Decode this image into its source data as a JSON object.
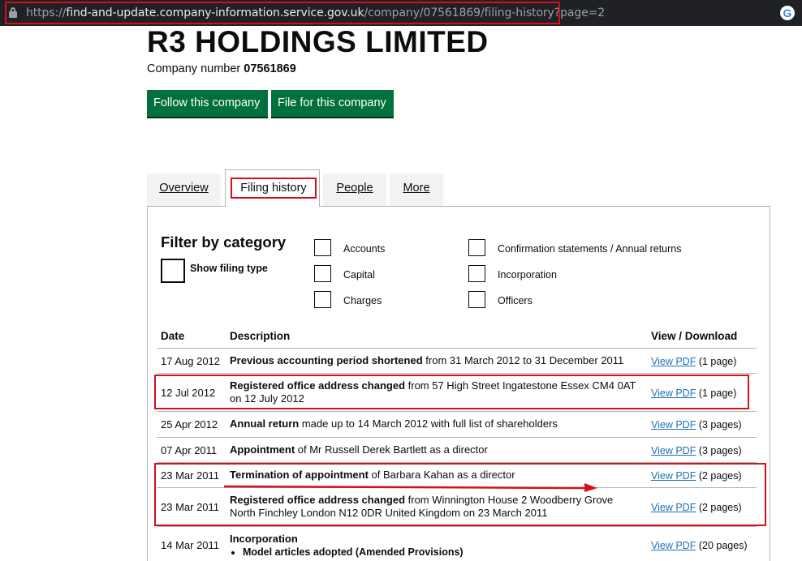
{
  "browser": {
    "url_scheme": "https://",
    "url_host": "find-and-update.company-information.service.gov.uk",
    "url_path": "/company/07561869/filing-history?page=2"
  },
  "company": {
    "name": "R3 HOLDINGS LIMITED",
    "number_label": "Company number",
    "number": "07561869"
  },
  "actions": {
    "follow": "Follow this company",
    "file": "File for this company"
  },
  "tabs": {
    "overview": "Overview",
    "filing_history": "Filing history",
    "people": "People",
    "more": "More"
  },
  "filter": {
    "title": "Filter by category",
    "show_filing_type": "Show filing type",
    "categories": {
      "accounts": "Accounts",
      "capital": "Capital",
      "charges": "Charges",
      "confirmation": "Confirmation statements / Annual returns",
      "incorporation": "Incorporation",
      "officers": "Officers"
    }
  },
  "table": {
    "headers": {
      "date": "Date",
      "description": "Description",
      "view": "View / Download"
    },
    "link_text": "View PDF",
    "rows": [
      {
        "date": "17 Aug 2012",
        "bold": "Previous accounting period shortened",
        "rest": " from 31 March 2012 to 31 December 2011",
        "pages": "(1 page)"
      },
      {
        "date": "12 Jul 2012",
        "bold": "Registered office address changed",
        "rest": " from 57 High Street Ingatestone Essex CM4 0AT on 12 July 2012",
        "pages": "(1 page)"
      },
      {
        "date": "25 Apr 2012",
        "bold": "Annual return",
        "rest": " made up to 14 March 2012 with full list of shareholders",
        "pages": "(3 pages)"
      },
      {
        "date": "07 Apr 2011",
        "bold": "Appointment",
        "rest": " of Mr Russell Derek Bartlett as a director",
        "pages": "(3 pages)"
      },
      {
        "date": "23 Mar 2011",
        "bold": "Termination of appointment",
        "rest": " of Barbara Kahan as a director",
        "pages": "(2 pages)"
      },
      {
        "date": "23 Mar 2011",
        "bold": "Registered office address changed",
        "rest": " from Winnington House 2 Woodberry Grove North Finchley London N12 0DR United Kingdom on 23 March 2011",
        "pages": "(2 pages)"
      },
      {
        "date": "14 Mar 2011",
        "bold": "Incorporation",
        "rest": "",
        "bullet": "Model articles adopted (Amended Provisions)",
        "pages": "(20 pages)"
      }
    ]
  },
  "colors": {
    "button_green": "#00703c",
    "link_blue": "#1d70b8",
    "annotation_red": "#d4111b",
    "address_bar": "#202124"
  }
}
